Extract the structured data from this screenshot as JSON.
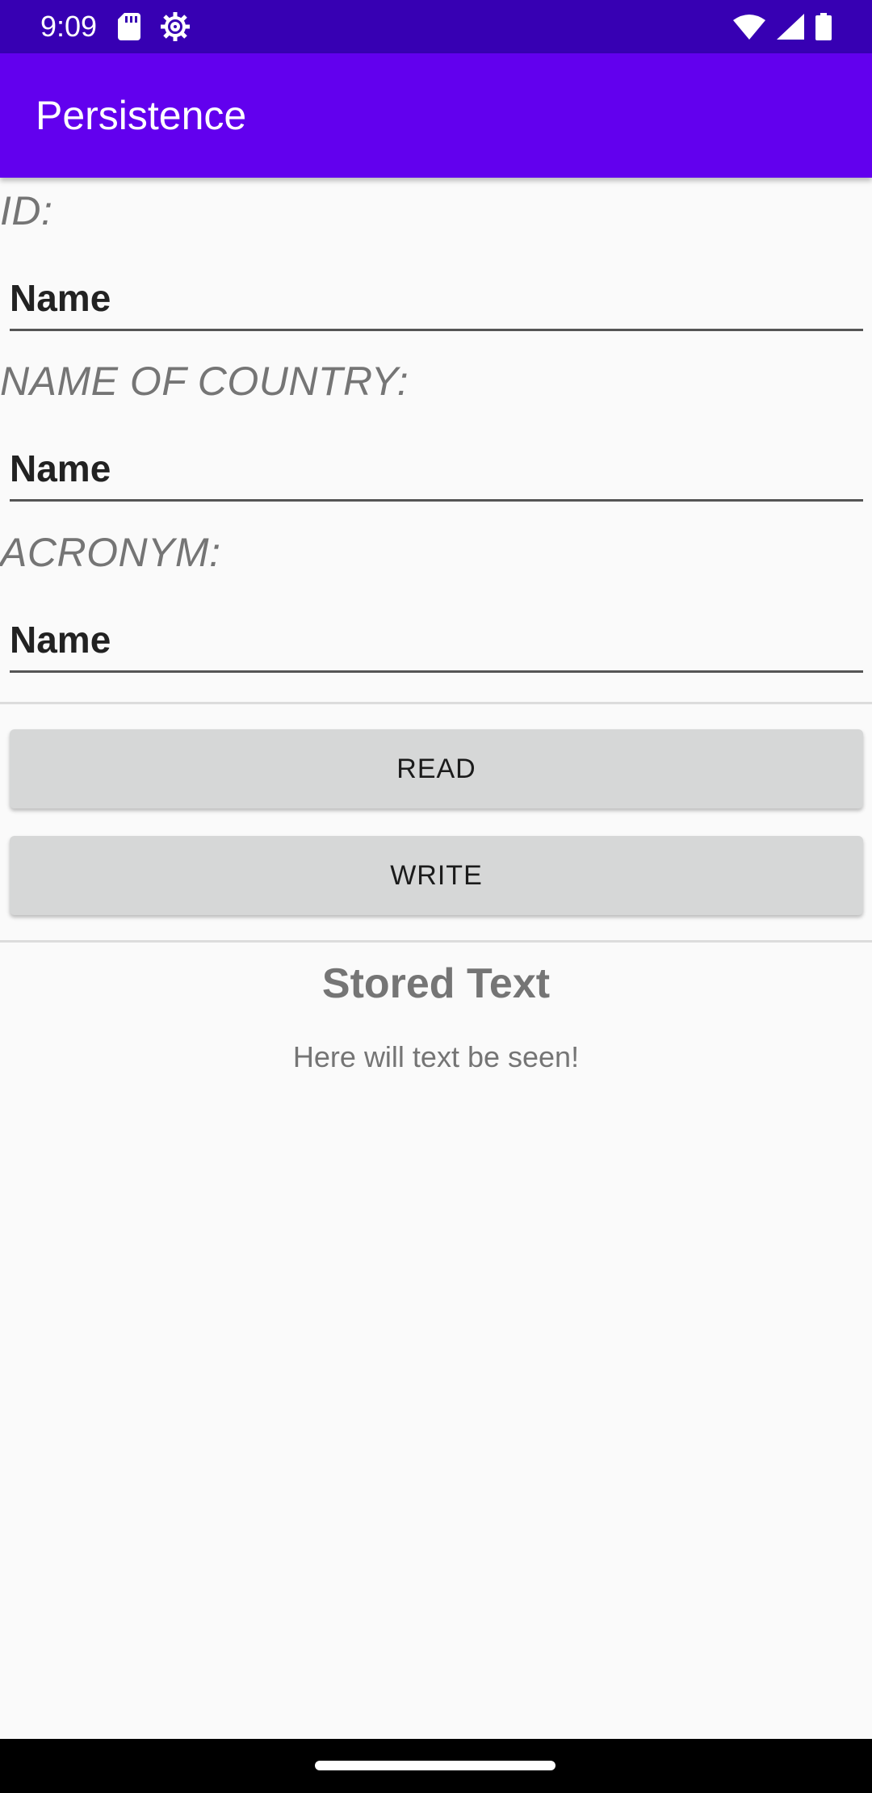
{
  "status_bar": {
    "time": "9:09",
    "icons": [
      "sd-card-icon",
      "settings-gear-icon",
      "wifi-icon",
      "signal-icon",
      "battery-icon"
    ]
  },
  "app_bar": {
    "title": "Persistence"
  },
  "form": {
    "fields": [
      {
        "label": "ID:",
        "placeholder": "Name"
      },
      {
        "label": "NAME OF COUNTRY:",
        "placeholder": "Name"
      },
      {
        "label": "ACRONYM:",
        "placeholder": "Name"
      }
    ]
  },
  "buttons": {
    "read": "READ",
    "write": "WRITE"
  },
  "stored": {
    "title": "Stored Text",
    "body": "Here will text be seen!"
  },
  "colors": {
    "status_bar": "#3700b3",
    "app_bar": "#6200ee",
    "background": "#fafafa",
    "button": "#d6d7d7",
    "label_gray": "#757575"
  }
}
